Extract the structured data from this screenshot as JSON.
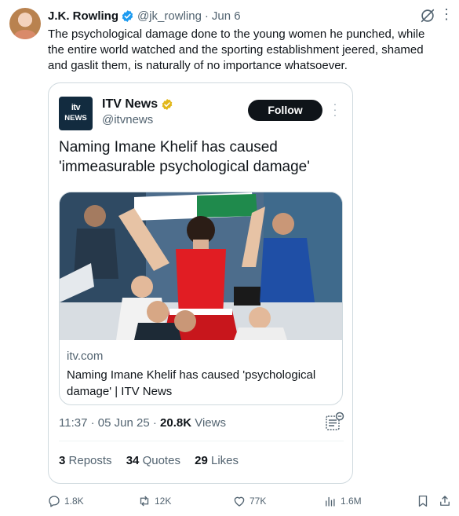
{
  "post": {
    "author_name": "J.K. Rowling",
    "handle": "@jk_rowling",
    "separator": "·",
    "date": "Jun 6",
    "text": "The psychological damage done to the young women he punched, while the entire world watched and the sporting establishment jeered, shamed and gaslit them, is naturally of no importance whatsoever."
  },
  "quoted": {
    "logo_line1": "itv",
    "logo_line2": "NEWS",
    "name": "ITV News",
    "handle": "@itvnews",
    "follow_label": "Follow",
    "headline": "Naming Imane Khelif has caused 'immeasurable psychological damage'",
    "card": {
      "domain": "itv.com",
      "title": "Naming Imane Khelif has caused 'psychological damage' | ITV News"
    },
    "time": "11:37",
    "sep": "·",
    "date": "05 Jun 25",
    "sep2": "·",
    "views_count": "20.8K",
    "views_label": "Views",
    "reposts_count": "3",
    "reposts_label": "Reposts",
    "quotes_count": "34",
    "quotes_label": "Quotes",
    "likes_count": "29",
    "likes_label": "Likes"
  },
  "actions": {
    "replies": "1.8K",
    "reposts": "12K",
    "likes": "77K",
    "views": "1.6M"
  },
  "colors": {
    "verified_blue": "#1d9bf0",
    "gold_badge": "#e2b719",
    "secondary_text": "#536471",
    "primary_text": "#0f1419"
  },
  "icons": [
    "verified-badge-icon",
    "grok-icon",
    "more-icon",
    "gold-verified-badge-icon",
    "note-icon",
    "reply-icon",
    "repost-icon",
    "like-icon",
    "views-icon",
    "bookmark-icon",
    "share-icon"
  ]
}
